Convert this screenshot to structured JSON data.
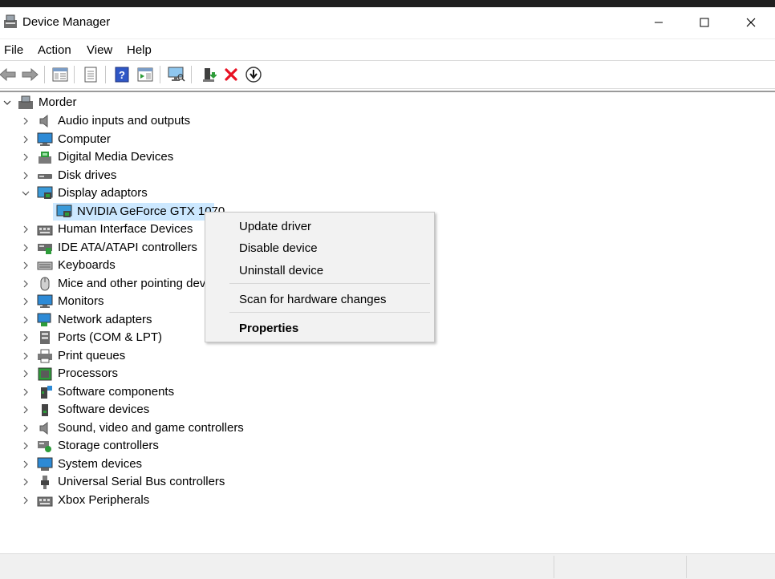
{
  "window": {
    "title": "Device Manager",
    "controls": {
      "minimize": "minimize",
      "maximize": "maximize",
      "close": "close"
    }
  },
  "menu": [
    "File",
    "Action",
    "View",
    "Help"
  ],
  "toolbar": {
    "icons": [
      "back-icon",
      "forward-icon",
      "properties-pane-icon",
      "details-icon",
      "help-icon",
      "action-pane-icon",
      "scan-monitor-icon",
      "update-driver-icon",
      "uninstall-x-icon",
      "download-icon"
    ]
  },
  "tree": {
    "root": "Morder",
    "categories": [
      {
        "label": "Audio inputs and outputs",
        "icon": "speaker-icon"
      },
      {
        "label": "Computer",
        "icon": "monitor-icon"
      },
      {
        "label": "Digital Media Devices",
        "icon": "media-device-icon"
      },
      {
        "label": "Disk drives",
        "icon": "disk-drive-icon"
      },
      {
        "label": "Display adaptors",
        "icon": "display-adapter-icon",
        "expanded": true,
        "children": [
          {
            "label": "NVIDIA GeForce GTX 1070",
            "icon": "display-adapter-icon",
            "selected": true
          }
        ]
      },
      {
        "label": "Human Interface Devices",
        "icon": "hid-icon"
      },
      {
        "label": "IDE ATA/ATAPI controllers",
        "icon": "ide-icon"
      },
      {
        "label": "Keyboards",
        "icon": "keyboard-icon"
      },
      {
        "label": "Mice and other pointing devices",
        "icon": "mouse-icon"
      },
      {
        "label": "Monitors",
        "icon": "monitor-icon"
      },
      {
        "label": "Network adapters",
        "icon": "network-icon"
      },
      {
        "label": "Ports (COM & LPT)",
        "icon": "port-icon"
      },
      {
        "label": "Print queues",
        "icon": "printer-icon"
      },
      {
        "label": "Processors",
        "icon": "processor-icon"
      },
      {
        "label": "Software components",
        "icon": "software-component-icon"
      },
      {
        "label": "Software devices",
        "icon": "software-device-icon"
      },
      {
        "label": "Sound, video and game controllers",
        "icon": "speaker-icon"
      },
      {
        "label": "Storage controllers",
        "icon": "storage-icon"
      },
      {
        "label": "System devices",
        "icon": "system-icon"
      },
      {
        "label": "Universal Serial Bus controllers",
        "icon": "usb-icon"
      },
      {
        "label": "Xbox Peripherals",
        "icon": "hid-icon"
      }
    ]
  },
  "context_menu": {
    "items": [
      {
        "label": "Update driver"
      },
      {
        "label": "Disable device"
      },
      {
        "label": "Uninstall device"
      },
      {
        "label": "Scan for hardware changes"
      },
      {
        "label": "Properties",
        "bold": true
      }
    ]
  },
  "colors": {
    "selection": "#cce8ff",
    "menu_bg": "#f2f2f2",
    "accent_blue": "#1e7fd6",
    "delete_red": "#e81123",
    "update_green": "#2e9c3a"
  }
}
